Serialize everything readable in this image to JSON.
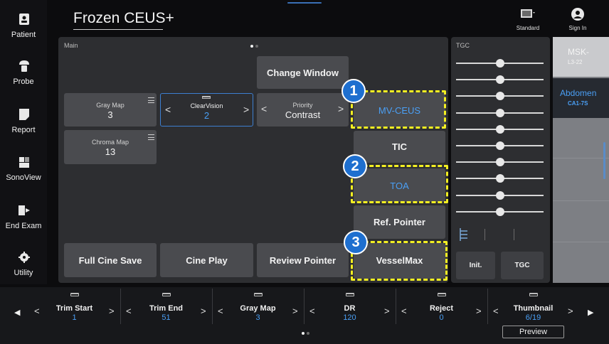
{
  "header": {
    "title": "Frozen CEUS+"
  },
  "topright": {
    "preset_label": "Standard",
    "signin_label": "Sign In"
  },
  "sidebar": {
    "items": [
      {
        "label": "Patient",
        "icon": "patient-icon"
      },
      {
        "label": "Probe",
        "icon": "probe-icon"
      },
      {
        "label": "Report",
        "icon": "report-icon"
      },
      {
        "label": "SonoView",
        "icon": "sonoview-icon"
      },
      {
        "label": "End Exam",
        "icon": "end-exam-icon"
      },
      {
        "label": "Utility",
        "icon": "gear-icon"
      }
    ]
  },
  "main": {
    "label": "Main",
    "change_window": "Change Window",
    "gray_map": {
      "label": "Gray Map",
      "value": "3"
    },
    "clearvision": {
      "label": "ClearVision",
      "value": "2"
    },
    "priority": {
      "label": "Priority",
      "value": "Contrast"
    },
    "chroma_map": {
      "label": "Chroma Map",
      "value": "13"
    },
    "full_cine_save": "Full Cine Save",
    "cine_play": "Cine Play",
    "review_pointer": "Review Pointer",
    "mv_ceus": "MV-CEUS",
    "tic": "TIC",
    "toa": "TOA",
    "ref_pointer": "Ref. Pointer",
    "vesselmax": "VesselMax"
  },
  "callouts": [
    "1",
    "2",
    "3"
  ],
  "colors": {
    "highlight": "#f3ef22",
    "accent_blue": "#4a9ff5",
    "badge_blue": "#1e6fcf"
  },
  "tgc": {
    "label": "TGC",
    "init": "Init.",
    "tgc_button": "TGC",
    "slider_levels": [
      0.5,
      0.5,
      0.5,
      0.5,
      0.5,
      0.5,
      0.5,
      0.5,
      0.5,
      0.5
    ]
  },
  "probes": [
    {
      "name": "MSK-",
      "model": "L3-22",
      "active": false
    },
    {
      "name": "Abdomen",
      "model": "CA1-7S",
      "active": true
    }
  ],
  "bottom": {
    "items": [
      {
        "label": "Trim Start",
        "value": "1"
      },
      {
        "label": "Trim End",
        "value": "51"
      },
      {
        "label": "Gray Map",
        "value": "3"
      },
      {
        "label": "DR",
        "value": "120"
      },
      {
        "label": "Reject",
        "value": "0"
      },
      {
        "label": "Thumbnail",
        "value": "6/19"
      }
    ],
    "preview": "Preview"
  }
}
